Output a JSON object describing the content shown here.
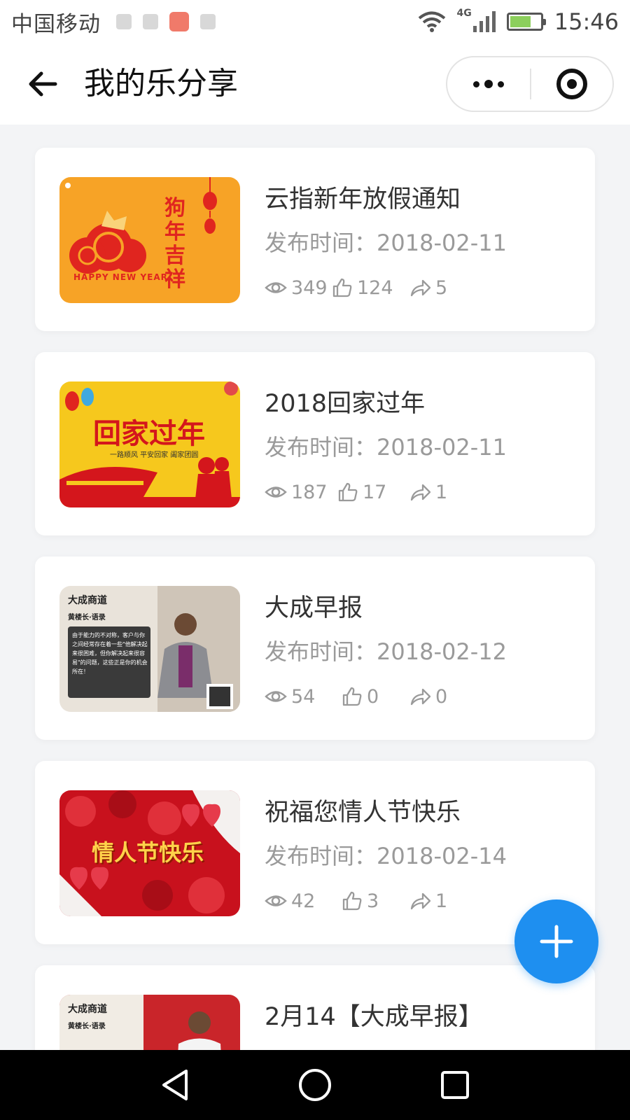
{
  "status_bar": {
    "carrier": "中国移动",
    "network": "4G",
    "time": "15:46"
  },
  "header": {
    "title": "我的乐分享"
  },
  "items": [
    {
      "title": "云指新年放假通知",
      "date": "发布时间：2018-02-11",
      "views": "349",
      "likes": "124",
      "shares": "5",
      "thumb": {
        "bg": "#f7a326",
        "text1": "狗年吉祥",
        "text2": "HAPPY NEW YEAR",
        "accent": "#e0251f"
      }
    },
    {
      "title": "2018回家过年",
      "date": "发布时间：2018-02-11",
      "views": "187",
      "likes": "17",
      "shares": "1",
      "thumb": {
        "bg": "#f6c81d",
        "text1": "回家过年",
        "text2": "一路顺风 平安回家 阖家团圆",
        "accent": "#d4161c"
      }
    },
    {
      "title": "大成早报",
      "date": "发布时间：2018-02-12",
      "views": "54",
      "likes": "0",
      "shares": "0",
      "thumb": {
        "bg": "#e9e3da",
        "text1": "大成商道",
        "text2": "黄楼长·语录",
        "text3": "由于能力的不对称，客户与你之间经常存在着一些\"他解决起来很困难，但你解决起来很容易\"的问题，这些正是你的机会所在！",
        "accent": "#222222"
      }
    },
    {
      "title": "祝福您情人节快乐",
      "date": "发布时间：2018-02-14",
      "views": "42",
      "likes": "3",
      "shares": "1",
      "thumb": {
        "bg": "#c8111d",
        "text1": "情人节快乐",
        "accent": "#ffd24a"
      }
    },
    {
      "title": "2月14【大成早报】",
      "thumb": {
        "bg": "#c9252a",
        "text1": "大成商道",
        "text2": "黄楼长·语录",
        "accent": "#222222"
      }
    }
  ],
  "icons": {
    "back": "arrow-left-icon",
    "more": "more-dots-icon",
    "target": "target-icon",
    "views": "eye-icon",
    "likes": "thumbs-up-icon",
    "shares": "share-icon",
    "add": "plus-icon"
  },
  "colors": {
    "accent": "#1e8ff0",
    "background": "#f3f4f6",
    "muted_text": "#9a9a9a"
  }
}
